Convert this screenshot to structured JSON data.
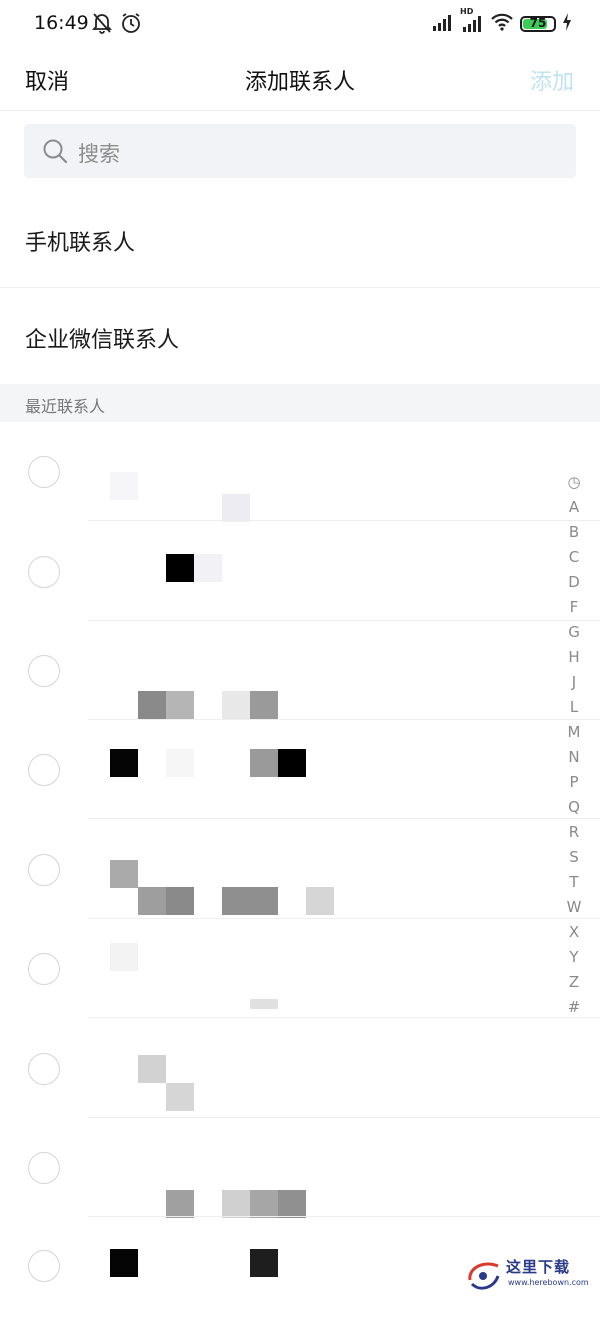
{
  "status_bar": {
    "time": "16:49",
    "battery": "75",
    "icons": [
      "bell-off-icon",
      "alarm-icon",
      "signal-icon",
      "hd-signal-icon",
      "wifi-icon",
      "battery-icon",
      "charging-icon"
    ],
    "hd_label": "HD",
    "battery_color": "#3ecb57"
  },
  "nav": {
    "cancel": "取消",
    "title": "添加联系人",
    "add": "添加",
    "add_color": "#bfe3f2"
  },
  "search": {
    "placeholder": "搜索"
  },
  "menu": {
    "phone_contacts": "手机联系人",
    "wecom_contacts": "企业微信联系人"
  },
  "section": {
    "recent": "最近联系人"
  },
  "contacts_count_visible": 9,
  "index_bar": [
    "◷",
    "A",
    "B",
    "C",
    "D",
    "F",
    "G",
    "H",
    "J",
    "L",
    "M",
    "N",
    "P",
    "Q",
    "R",
    "S",
    "T",
    "W",
    "X",
    "Y",
    "Z",
    "#"
  ],
  "watermark": {
    "text": "这里下载",
    "url": "www.herebown.com"
  }
}
